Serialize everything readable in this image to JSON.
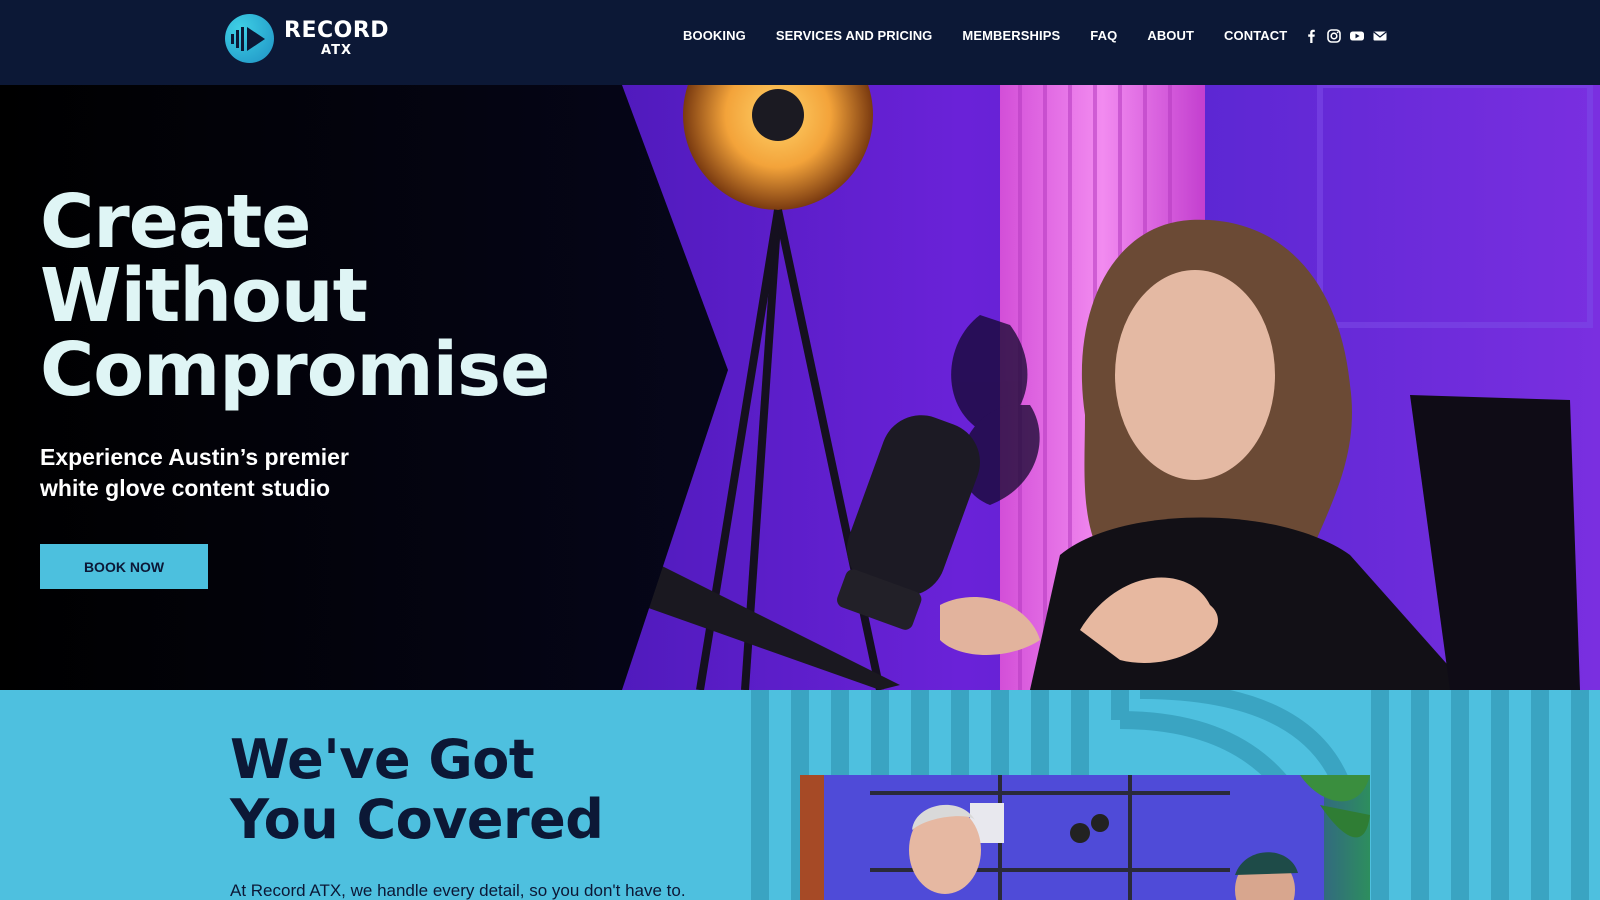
{
  "brand": {
    "name": "RECORD",
    "sub": "ATX",
    "accent": "#4cc0de",
    "navy": "#0c1836"
  },
  "nav": {
    "items": [
      {
        "label": "BOOKING"
      },
      {
        "label": "SERVICES AND PRICING"
      },
      {
        "label": "MEMBERSHIPS"
      },
      {
        "label": "FAQ"
      },
      {
        "label": "ABOUT"
      },
      {
        "label": "CONTACT"
      }
    ],
    "social": [
      "facebook-icon",
      "instagram-icon",
      "youtube-icon",
      "email-icon"
    ]
  },
  "hero": {
    "title_line1": "Create",
    "title_line2": "Without",
    "title_line3": "Compromise",
    "subtitle": "Experience Austin’s premier white glove content studio",
    "cta": "BOOK NOW"
  },
  "section2": {
    "title_line1": "We've Got",
    "title_line2": "You Covered",
    "body": "At Record ATX, we handle every detail, so you don't have to."
  }
}
